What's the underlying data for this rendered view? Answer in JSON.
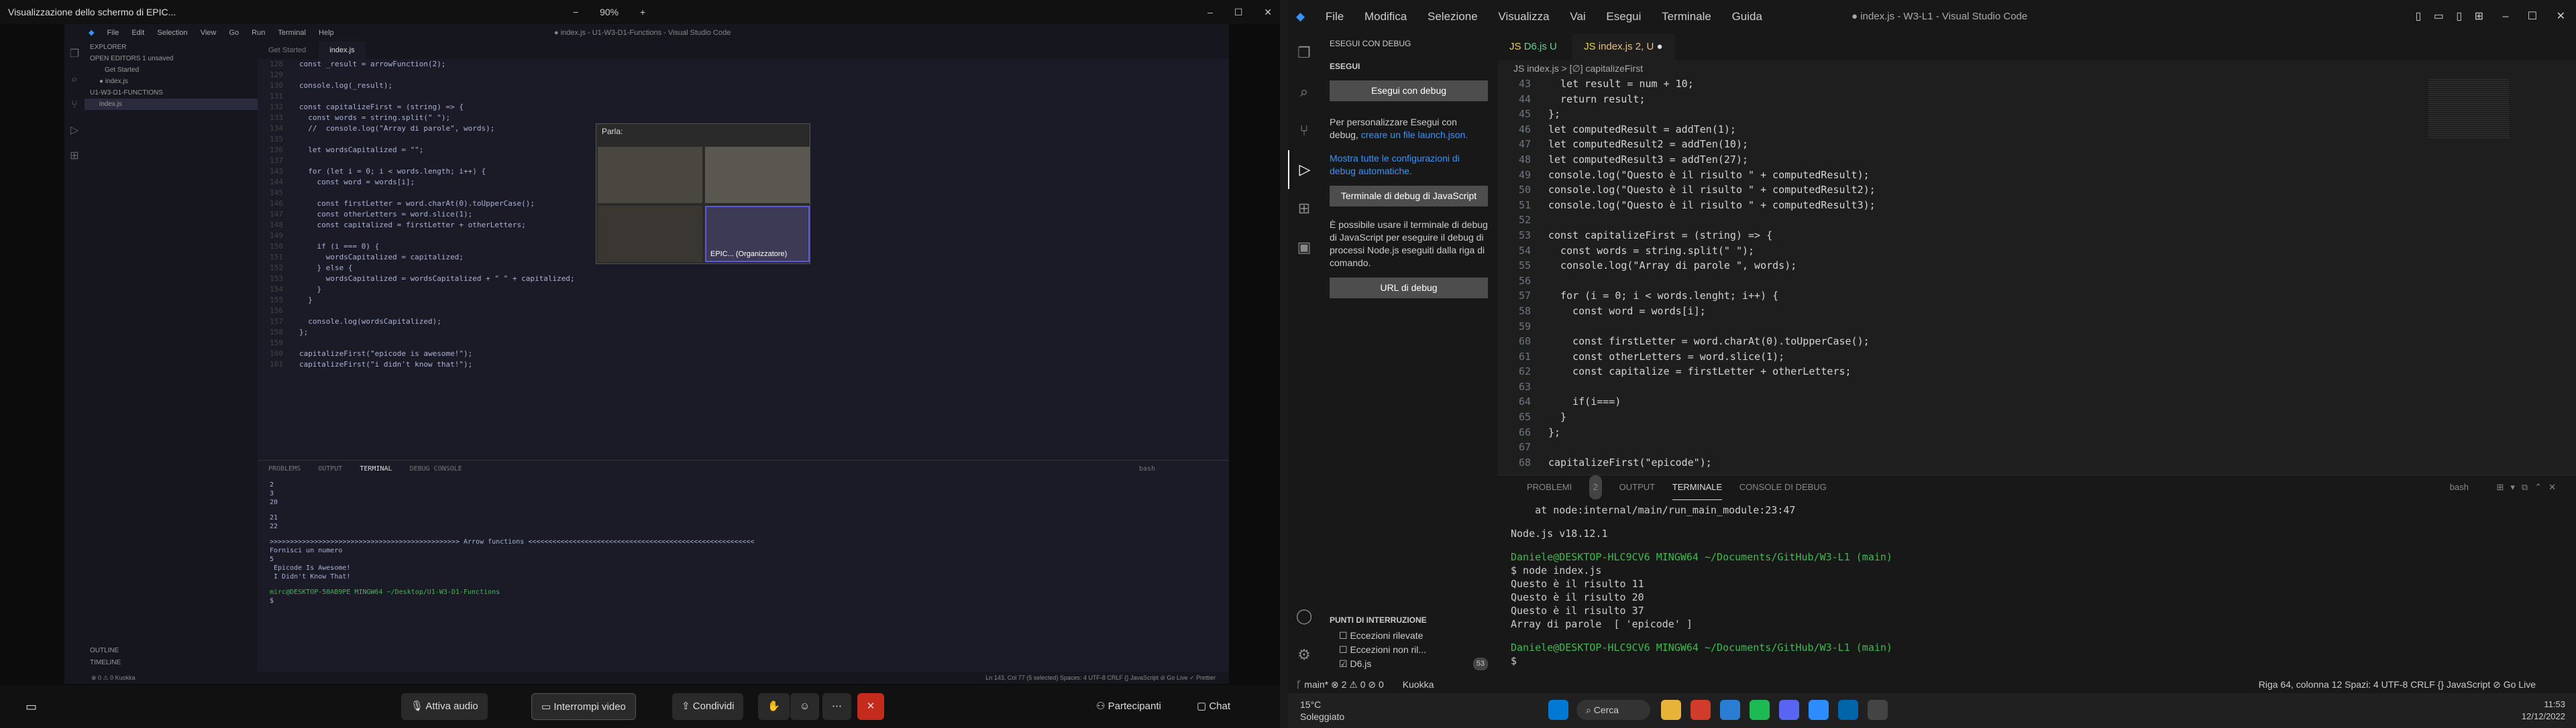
{
  "share": {
    "window_title": "Visualizzazione dello schermo di EPIC...",
    "zoom_minus": "−",
    "zoom_level": "90%",
    "zoom_plus": "+",
    "win_controls": [
      "–",
      "☐",
      "✕"
    ]
  },
  "left_vscode": {
    "menu": [
      "File",
      "Edit",
      "Selection",
      "View",
      "Go",
      "Run",
      "Terminal",
      "Help"
    ],
    "title": "● index.js - U1-W3-D1-Functions - Visual Studio Code",
    "sidebar": [
      "EXPLORER",
      "OPEN EDITORS  1 unsaved",
      "Get Started",
      "● index.js",
      "U1-W3-D1-FUNCTIONS",
      "index.js"
    ],
    "sidebar_bottom": [
      "OUTLINE",
      "TIMELINE"
    ],
    "tabs": [
      "Get Started",
      "index.js"
    ],
    "code": [
      {
        "n": "128",
        "t": "const _result = arrowFunction(2);"
      },
      {
        "n": "129",
        "t": ""
      },
      {
        "n": "130",
        "t": "console.log(_result);"
      },
      {
        "n": "131",
        "t": ""
      },
      {
        "n": "132",
        "t": "const capitalizeFirst = (string) => {"
      },
      {
        "n": "133",
        "t": "  const words = string.split(\" \");"
      },
      {
        "n": "134",
        "t": "  //  console.log(\"Array di parole\", words);"
      },
      {
        "n": "135",
        "t": ""
      },
      {
        "n": "136",
        "t": "  let wordsCapitalized = \"\";"
      },
      {
        "n": "137",
        "t": ""
      },
      {
        "n": "143",
        "t": "  for (let i = 0; i < words.length; i++) {"
      },
      {
        "n": "144",
        "t": "    const word = words[i];"
      },
      {
        "n": "145",
        "t": ""
      },
      {
        "n": "146",
        "t": "    const firstLetter = word.charAt(0).toUpperCase();"
      },
      {
        "n": "147",
        "t": "    const otherLetters = word.slice(1);"
      },
      {
        "n": "148",
        "t": "    const capitalized = firstLetter + otherLetters;"
      },
      {
        "n": "149",
        "t": ""
      },
      {
        "n": "150",
        "t": "    if (i === 0) {"
      },
      {
        "n": "151",
        "t": "      wordsCapitalized = capitalized;"
      },
      {
        "n": "152",
        "t": "    } else {"
      },
      {
        "n": "153",
        "t": "      wordsCapitalized = wordsCapitalized + \" \" + capitalized;"
      },
      {
        "n": "154",
        "t": "    }"
      },
      {
        "n": "155",
        "t": "  }"
      },
      {
        "n": "156",
        "t": ""
      },
      {
        "n": "157",
        "t": "  console.log(wordsCapitalized);"
      },
      {
        "n": "158",
        "t": "};"
      },
      {
        "n": "159",
        "t": ""
      },
      {
        "n": "160",
        "t": "capitalizeFirst(\"epicode is awesome!\");"
      },
      {
        "n": "161",
        "t": "capitalizeFirst(\"i didn't know that!\");"
      }
    ],
    "term_tabs": [
      "PROBLEMS",
      "OUTPUT",
      "TERMINAL",
      "DEBUG CONSOLE"
    ],
    "term_shell": "bash",
    "term_lines": [
      "2",
      "3",
      "20",
      "",
      "21",
      "22",
      "",
      ">>>>>>>>>>>>>>>>>>>>>>>>>>>>>>>>>>>>>>>>>>>>>>> Arrow functions <<<<<<<<<<<<<<<<<<<<<<<<<<<<<<<<<<<<<<<<<<<<<<<<<<<<<<<<",
      "Fornisci un numero",
      "5",
      " Epicode Is Awesome!",
      " I Didn't Know That!",
      "",
      "mirc@DESKTOP-50AB9PE MINGW64 ~/Desktop/U1-W3-D1-Functions",
      "$ "
    ],
    "status_left": "⊗ 0 ⚠ 0    Kuokka",
    "status_right": "Ln 143, Col 77 (5 selected)   Spaces: 4   UTF-8   CRLF   {} JavaScript   ⊘ Go Live   ✓ Prettier"
  },
  "video": {
    "label": "Parla:",
    "tile_name": "EPIC... (Organizzatore)"
  },
  "call_bar": {
    "audio": "Attiva audio",
    "video": "Interrompi video",
    "share": "Condividi",
    "participants": "Partecipanti",
    "chat": "Chat"
  },
  "right_vscode": {
    "menu": [
      "File",
      "Modifica",
      "Selezione",
      "Visualizza",
      "Vai",
      "Esegui",
      "Terminale",
      "Guida"
    ],
    "title": "● index.js - W3-L1 - Visual Studio Code",
    "side_title": "ESEGUI CON DEBUG",
    "side_section": "ESEGUI",
    "run_debug_btn": "Esegui con debug",
    "side_text1": "Per personalizzare Esegui con debug,",
    "side_link1": "creare un file launch.json.",
    "side_link2": "Mostra tutte le configurazioni di debug automatiche.",
    "js_term_btn": "Terminale di debug di JavaScript",
    "side_text2": "È possibile usare il terminale di debug di JavaScript per eseguire il debug di processi Node.js eseguiti dalla riga di comando.",
    "url_btn": "URL di debug",
    "breakpoints_title": "PUNTI DI INTERRUZIONE",
    "breakpoints": [
      "Eccezioni rilevate",
      "Eccezioni non ril...",
      "D6.js"
    ],
    "breakpoint_count": "53",
    "tabs": [
      {
        "label": "D6.js",
        "mark": "U"
      },
      {
        "label": "index.js",
        "mark": "2, U"
      }
    ],
    "crumb": "JS index.js  >  [∅] capitalizeFirst",
    "code": [
      {
        "n": "43",
        "t": "  let result = num + 10;"
      },
      {
        "n": "44",
        "t": "  return result;"
      },
      {
        "n": "45",
        "t": "};"
      },
      {
        "n": "46",
        "t": "let computedResult = addTen(1);"
      },
      {
        "n": "47",
        "t": "let computedResult2 = addTen(10);"
      },
      {
        "n": "48",
        "t": "let computedResult3 = addTen(27);"
      },
      {
        "n": "49",
        "t": "console.log(\"Questo è il risulto \" + computedResult);"
      },
      {
        "n": "50",
        "t": "console.log(\"Questo è il risulto \" + computedResult2);"
      },
      {
        "n": "51",
        "t": "console.log(\"Questo è il risulto \" + computedResult3);"
      },
      {
        "n": "52",
        "t": ""
      },
      {
        "n": "53",
        "t": "const capitalizeFirst = (string) => {"
      },
      {
        "n": "54",
        "t": "  const words = string.split(\" \");"
      },
      {
        "n": "55",
        "t": "  console.log(\"Array di parole \", words);"
      },
      {
        "n": "56",
        "t": ""
      },
      {
        "n": "57",
        "t": "  for (i = 0; i < words.lenght; i++) {"
      },
      {
        "n": "58",
        "t": "    const word = words[i];"
      },
      {
        "n": "59",
        "t": ""
      },
      {
        "n": "60",
        "t": "    const firstLetter = word.charAt(0).toUpperCase();"
      },
      {
        "n": "61",
        "t": "    const otherLetters = word.slice(1);"
      },
      {
        "n": "62",
        "t": "    const capitalize = firstLetter + otherLetters;"
      },
      {
        "n": "63",
        "t": ""
      },
      {
        "n": "64",
        "t": "    if(i===)"
      },
      {
        "n": "65",
        "t": "  }"
      },
      {
        "n": "66",
        "t": "};"
      },
      {
        "n": "67",
        "t": ""
      },
      {
        "n": "68",
        "t": "capitalizeFirst(\"epicode\");"
      }
    ],
    "panel_tabs": [
      "PROBLEMI",
      "OUTPUT",
      "TERMINALE",
      "CONSOLE DI DEBUG"
    ],
    "problems_count": "2",
    "panel_shell": "bash",
    "term_lines": [
      "    at node:internal/main/run_main_module:23:47",
      "",
      "Node.js v18.12.1",
      "",
      "Daniele@DESKTOP-HLC9CV6 MINGW64 ~/Documents/GitHub/W3-L1 (main)",
      "$ node index.js",
      "Questo è il risulto 11",
      "Questo è il risulto 20",
      "Questo è il risulto 37",
      "Array di parole  [ 'epicode' ]",
      "",
      "Daniele@DESKTOP-HLC9CV6 MINGW64 ~/Documents/GitHub/W3-L1 (main)",
      "$ "
    ],
    "status_left": "ᚴ main*   ⊗ 2 ⚠ 0   ⊘ 0",
    "status_kuokka": "Kuokka",
    "status_right": "Riga 64, colonna 12   Spazi: 4   UTF-8   CRLF   {} JavaScript   ⊘ Go Live",
    "taskbar_weather": "15°C Soleggiato",
    "taskbar_search": "Cerca",
    "clock_time": "11:53",
    "clock_date": "12/12/2022"
  }
}
